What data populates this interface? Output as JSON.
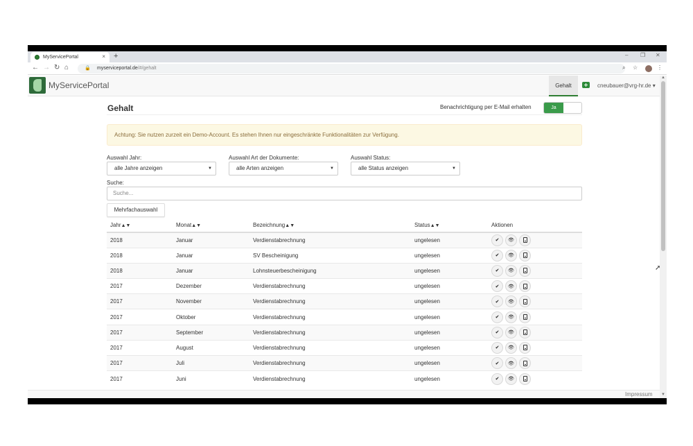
{
  "browser": {
    "tab_title": "MyServicePortal",
    "tab_close": "×",
    "new_tab": "+",
    "url_host": "myserviceportal.de",
    "url_path": "/#/gehalt",
    "win_min": "–",
    "win_max": "❐",
    "win_close": "✕"
  },
  "app": {
    "brand": "MyServicePortal",
    "nav_active": "Gehalt",
    "user": "cneubauer@vrg-hr.de",
    "footer_link": "Impressum"
  },
  "page": {
    "title": "Gehalt",
    "notify_label": "Benachrichtigung per E-Mail erhalten",
    "notify_value": "Ja",
    "alert": "Achtung: Sie nutzen zurzeit ein Demo-Account. Es stehen Ihnen nur eingeschränkte Funktionalitäten zur Verfügung."
  },
  "filters": {
    "year_label": "Auswahl Jahr:",
    "year_value": "alle Jahre anzeigen",
    "type_label": "Auswahl Art der Dokumente:",
    "type_value": "alle Arten anzeigen",
    "status_label": "Auswahl Status:",
    "status_value": "alle Status anzeigen",
    "search_label": "Suche:",
    "search_placeholder": "Suche...",
    "multi_button": "Mehrfachauswahl"
  },
  "table": {
    "headers": {
      "jahr": "Jahr",
      "monat": "Monat",
      "bezeichnung": "Bezeichnung",
      "status": "Status",
      "aktionen": "Aktionen",
      "sort_arrows": "▲▼"
    },
    "rows": [
      {
        "jahr": "2018",
        "monat": "Januar",
        "bezeichnung": "Verdienstabrechnung",
        "status": "ungelesen"
      },
      {
        "jahr": "2018",
        "monat": "Januar",
        "bezeichnung": "SV Bescheinigung",
        "status": "ungelesen"
      },
      {
        "jahr": "2018",
        "monat": "Januar",
        "bezeichnung": "Lohnsteuerbescheinigung",
        "status": "ungelesen"
      },
      {
        "jahr": "2017",
        "monat": "Dezember",
        "bezeichnung": "Verdienstabrechnung",
        "status": "ungelesen"
      },
      {
        "jahr": "2017",
        "monat": "November",
        "bezeichnung": "Verdienstabrechnung",
        "status": "ungelesen"
      },
      {
        "jahr": "2017",
        "monat": "Oktober",
        "bezeichnung": "Verdienstabrechnung",
        "status": "ungelesen"
      },
      {
        "jahr": "2017",
        "monat": "September",
        "bezeichnung": "Verdienstabrechnung",
        "status": "ungelesen"
      },
      {
        "jahr": "2017",
        "monat": "August",
        "bezeichnung": "Verdienstabrechnung",
        "status": "ungelesen"
      },
      {
        "jahr": "2017",
        "monat": "Juli",
        "bezeichnung": "Verdienstabrechnung",
        "status": "ungelesen"
      },
      {
        "jahr": "2017",
        "monat": "Juni",
        "bezeichnung": "Verdienstabrechnung",
        "status": "ungelesen"
      }
    ],
    "action_icons": [
      "checkmark-icon",
      "eye-icon",
      "document-icon"
    ]
  },
  "colors": {
    "accent": "#3a9b4a",
    "alert_bg": "#fcf8e3",
    "alert_text": "#8a6d3b"
  }
}
